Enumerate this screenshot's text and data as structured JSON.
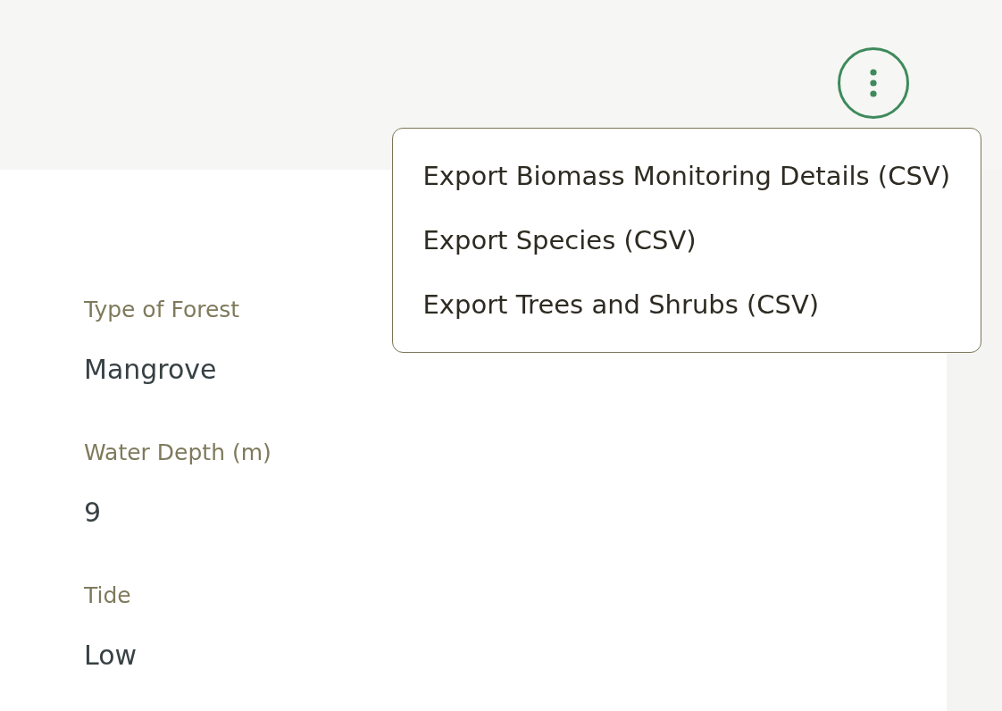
{
  "menu_button": {
    "expanded": true
  },
  "menu": {
    "items": [
      {
        "label": "Export Biomass Monitoring Details (CSV)"
      },
      {
        "label": "Export Species (CSV)"
      },
      {
        "label": "Export Trees and Shrubs (CSV)"
      }
    ]
  },
  "details": [
    {
      "label": "Type of Forest",
      "value": "Mangrove"
    },
    {
      "label": "Water Depth (m)",
      "value": "9"
    },
    {
      "label": "Tide",
      "value": "Low"
    }
  ]
}
